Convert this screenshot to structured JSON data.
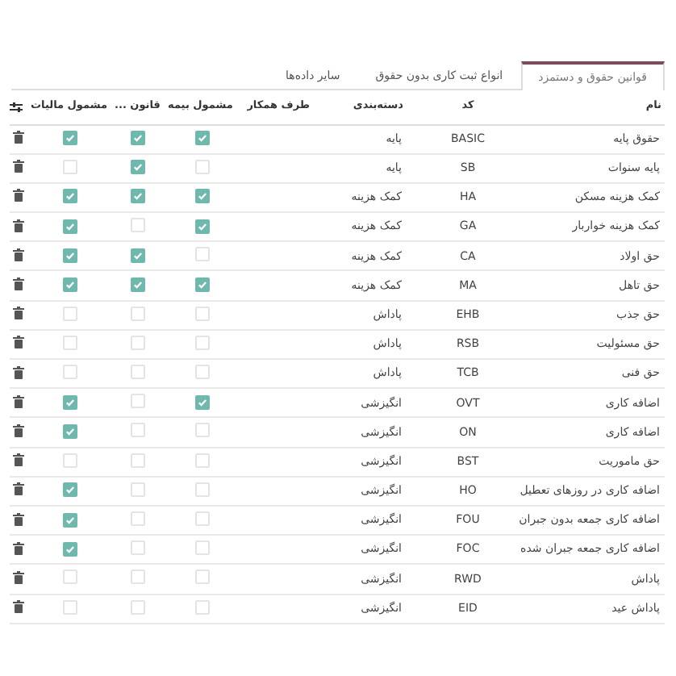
{
  "tabs": [
    {
      "label": "قوانین حقوق و دستمزد",
      "selected": true
    },
    {
      "label": "انواع ثبت کاری بدون حقوق",
      "selected": false
    },
    {
      "label": "سایر داده‌ها",
      "selected": false
    }
  ],
  "table": {
    "columns": [
      "نام",
      "کد",
      "دسته‌بندی",
      "طرف همکار",
      "مشمول بیمه",
      "قانون ...",
      "مشمول مالیات"
    ],
    "rows": [
      {
        "name": "حقوق پایه",
        "code": "BASIC",
        "category": "پایه",
        "insurance": true,
        "law": true,
        "tax": true
      },
      {
        "name": "پایه سنوات",
        "code": "SB",
        "category": "پایه",
        "insurance": false,
        "law": true,
        "tax": false
      },
      {
        "name": "کمک هزینه مسکن",
        "code": "HA",
        "category": "کمک هزینه",
        "insurance": true,
        "law": true,
        "tax": true
      },
      {
        "name": "کمک هزینه خواربار",
        "code": "GA",
        "category": "کمک هزینه",
        "insurance": true,
        "law": false,
        "tax": true
      },
      {
        "name": "حق اولاد",
        "code": "CA",
        "category": "کمک هزینه",
        "insurance": false,
        "law": true,
        "tax": true
      },
      {
        "name": "حق تاهل",
        "code": "MA",
        "category": "کمک هزینه",
        "insurance": true,
        "law": true,
        "tax": true
      },
      {
        "name": "حق جذب",
        "code": "EHB",
        "category": "پاداش",
        "insurance": false,
        "law": false,
        "tax": false
      },
      {
        "name": "حق مسئولیت",
        "code": "RSB",
        "category": "پاداش",
        "insurance": false,
        "law": false,
        "tax": false
      },
      {
        "name": "حق فنی",
        "code": "TCB",
        "category": "پاداش",
        "insurance": false,
        "law": false,
        "tax": false
      },
      {
        "name": "اضافه کاری",
        "code": "OVT",
        "category": "انگیزشی",
        "insurance": true,
        "law": false,
        "tax": true
      },
      {
        "name": "اضافه کاری",
        "code": "ON",
        "category": "انگیزشی",
        "insurance": false,
        "law": false,
        "tax": true
      },
      {
        "name": "حق ماموریت",
        "code": "BST",
        "category": "انگیزشی",
        "insurance": false,
        "law": false,
        "tax": false
      },
      {
        "name": "اضافه کاری در روزهای تعطیل",
        "code": "HO",
        "category": "انگیزشی",
        "insurance": false,
        "law": false,
        "tax": true
      },
      {
        "name": "اضافه کاری جمعه بدون جبران",
        "code": "FOU",
        "category": "انگیزشی",
        "insurance": false,
        "law": false,
        "tax": true
      },
      {
        "name": "اضافه کاری جمعه جبران شده",
        "code": "FOC",
        "category": "انگیزشی",
        "insurance": false,
        "law": false,
        "tax": true
      },
      {
        "name": "پاداش",
        "code": "RWD",
        "category": "انگیزشی",
        "insurance": false,
        "law": false,
        "tax": false
      },
      {
        "name": "پاداش عید",
        "code": "EID",
        "category": "انگیزشی",
        "insurance": false,
        "law": false,
        "tax": false
      }
    ]
  }
}
